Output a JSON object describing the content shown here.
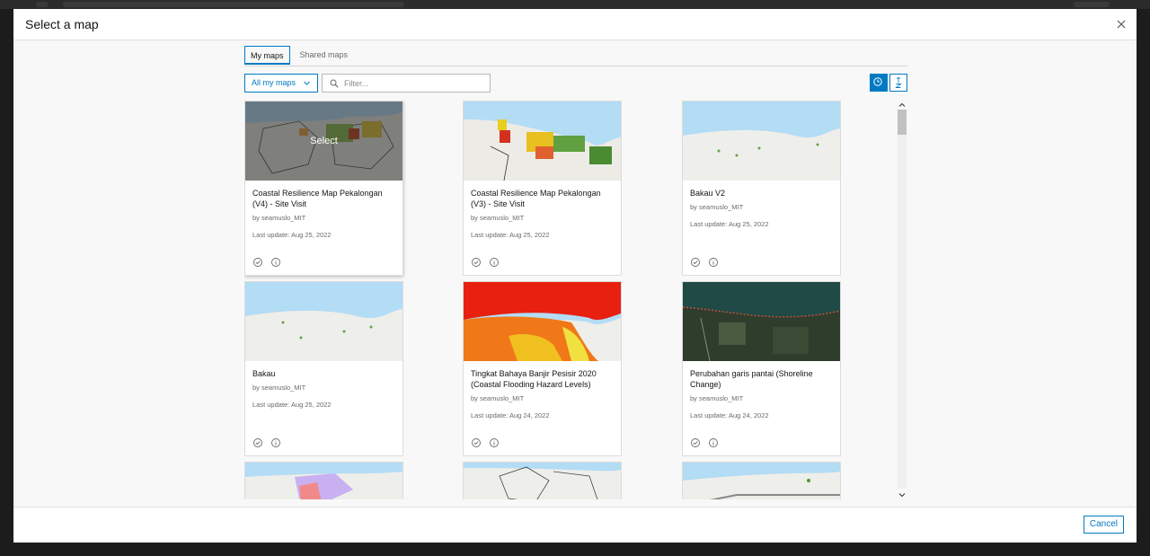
{
  "dialog": {
    "title": "Select a map",
    "cancel_label": "Cancel"
  },
  "tabs": [
    {
      "label": "My maps",
      "active": true
    },
    {
      "label": "Shared maps",
      "active": false
    }
  ],
  "toolbar": {
    "dropdown_label": "All my maps",
    "filter_placeholder": "Filter...",
    "sort_recent_icon": "clock-icon",
    "sort_alpha_icon": "sort-az-icon"
  },
  "hover_overlay_label": "Select",
  "cards": [
    {
      "title": "Coastal Resilience Map Pekalongan (V4) - Site Visit",
      "owner": "by seamuslo_MIT",
      "updated": "Last update: Aug 25, 2022"
    },
    {
      "title": "Coastal Resilience Map Pekalongan (V3) - Site Visit",
      "owner": "by seamuslo_MIT",
      "updated": "Last update: Aug 25, 2022"
    },
    {
      "title": "Bakau V2",
      "owner": "by seamuslo_MIT",
      "updated": "Last update: Aug 25, 2022"
    },
    {
      "title": "Bakau",
      "owner": "by seamuslo_MIT",
      "updated": "Last update: Aug 25, 2022"
    },
    {
      "title": "Tingkat Bahaya Banjir Pesisir 2020 (Coastal Flooding Hazard Levels)",
      "owner": "by seamuslo_MIT",
      "updated": "Last update: Aug 24, 2022"
    },
    {
      "title": "Perubahan garis pantai (Shoreline Change)",
      "owner": "by seamuslo_MIT",
      "updated": "Last update: Aug 24, 2022"
    }
  ],
  "colors": {
    "accent": "#007ac2",
    "water": "#b3dcf5",
    "land": "#eeeeea"
  }
}
